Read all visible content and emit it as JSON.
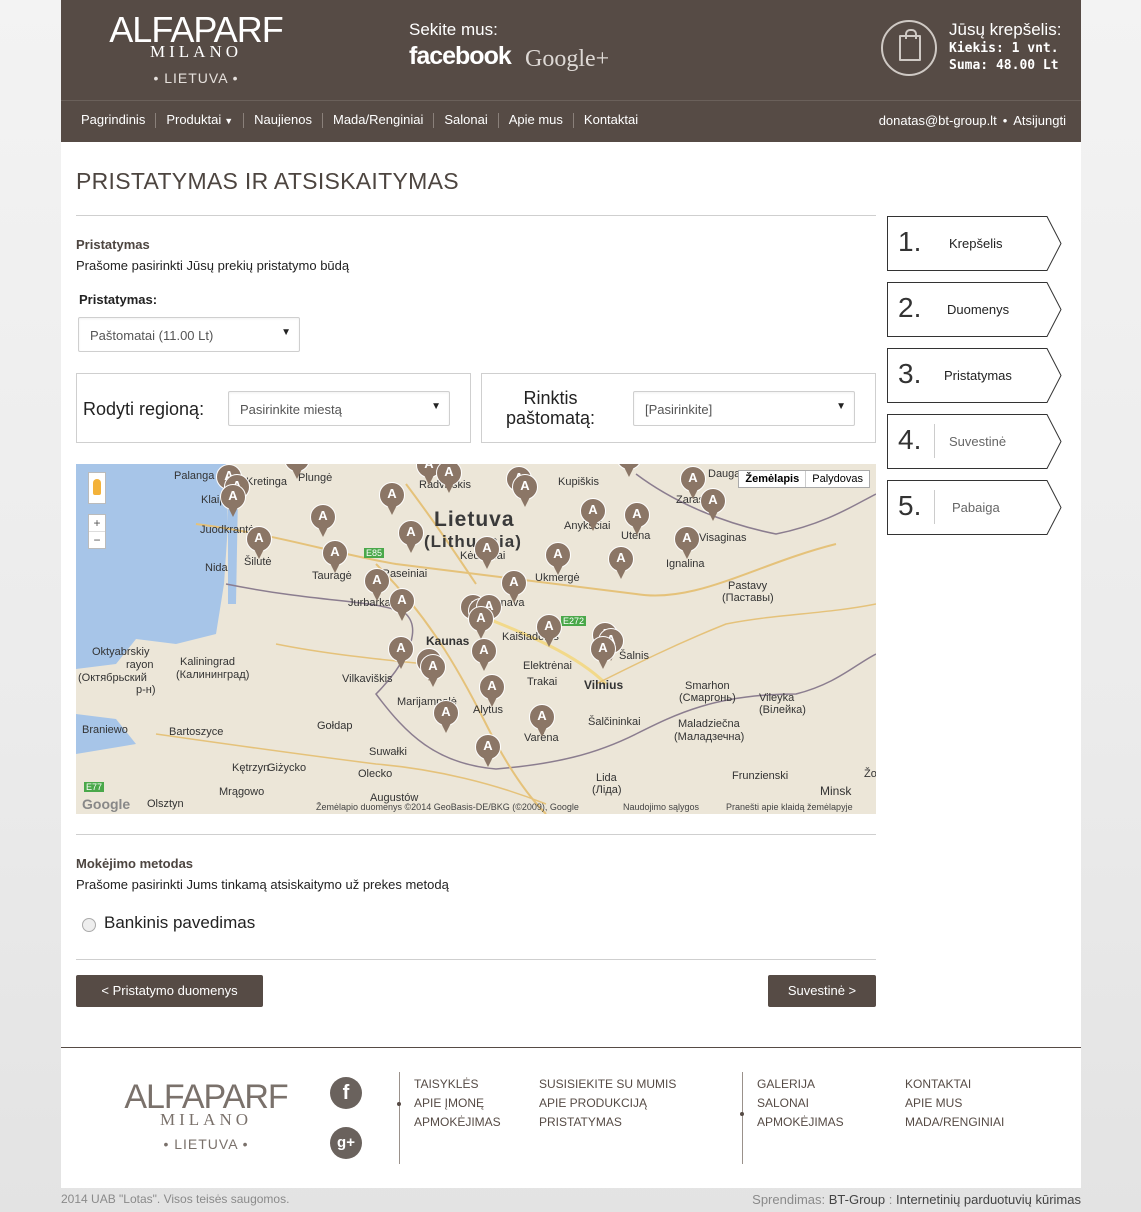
{
  "header": {
    "logo": {
      "line1": "ALFAPARF",
      "line2": "MILANO",
      "line3": "• LIETUVA •"
    },
    "follow_label": "Sekite mus:",
    "facebook": "facebook",
    "google": "Google+",
    "cart_title": "Jūsų krepšelis:",
    "cart_qty": "Kiekis: 1 vnt.",
    "cart_sum": "Suma: 48.00 Lt"
  },
  "nav": {
    "items": [
      "Pagrindinis",
      "Produktai",
      "Naujienos",
      "Mada/Renginiai",
      "Salonai",
      "Apie mus",
      "Kontaktai"
    ],
    "user": "donatas@bt-group.lt",
    "logout": "Atsijungti"
  },
  "page_title": "PRISTATYMAS IR ATSISKAITYMAS",
  "delivery": {
    "title": "Pristatymas",
    "subtitle": "Prašome pasirinkti Jūsų prekių pristatymo būdą",
    "select_label": "Pristatymas:",
    "select_value": "Paštomatai (11.00 Lt)",
    "region_label": "Rodyti regioną:",
    "region_value": "Pasirinkite miestą",
    "locker_label_1": "Rinktis",
    "locker_label_2": "paštomatą:",
    "locker_value": "[Pasirinkite]"
  },
  "map": {
    "type_map": "Žemėlapis",
    "type_sat": "Palydovas",
    "country": "Lietuva",
    "country_alt": "(Lithuania)",
    "attribution": "Žemėlapio duomenys ©2014 GeoBasis-DE/BKG (©2009), Google",
    "terms": "Naudojimo sąlygos",
    "report": "Pranešti apie klaidą žemėlapyje",
    "google": "Google",
    "cities": [
      "Palanga",
      "Kretinga",
      "Plungė",
      "Radviliškis",
      "Kupiškis",
      "Zarasai",
      "Klaipėda",
      "Juodkrantė",
      "Šilutė",
      "Nida",
      "Tauragė",
      "Raseiniai",
      "Jurbarkas",
      "Kėdainiai",
      "Anykščiai",
      "Utena",
      "Visaginas",
      "Ignalina",
      "Ukmergė",
      "Jonava",
      "Kaunas",
      "Kaišiadorys",
      "Elektrėnai",
      "Trakai",
      "Vilnius",
      "Pastavy",
      "(Паставы)",
      "Oktyabrskiy",
      "rayon",
      "(Октябрьский",
      "р-н)",
      "Kaliningrad",
      "(Калининград)",
      "Vilkaviškis",
      "Marijampolė",
      "Alytus",
      "Smarhon",
      "(Смаргонь)",
      "Vileyka",
      "(Вілейка)",
      "Braniewo",
      "Bartoszyce",
      "Gołdap",
      "Varėna",
      "Šalčininkai",
      "Maladziečna",
      "(Маладзечна)",
      "Suwałki",
      "Kętrzyn",
      "Giżycko",
      "Olecko",
      "Lida",
      "(Ліда)",
      "Mrągowo",
      "Augustów",
      "Frunzienski",
      "Olsztyn",
      "Minsk",
      "Daugavp",
      "Šalnis",
      "E85",
      "E272",
      "E77",
      "Žo"
    ]
  },
  "payment": {
    "title": "Mokėjimo metodas",
    "subtitle": "Prašome pasirinkti Jums tinkamą atsiskaitymo už prekes metodą",
    "option": "Bankinis pavedimas"
  },
  "buttons": {
    "back": "< Pristatymo duomenys",
    "next": "Suvestinė >"
  },
  "steps": [
    {
      "n": "1.",
      "label": "Krepšelis"
    },
    {
      "n": "2.",
      "label": "Duomenys"
    },
    {
      "n": "3.",
      "label": "Pristatymas"
    },
    {
      "n": "4.",
      "label": "Suvestinė"
    },
    {
      "n": "5.",
      "label": "Pabaiga"
    }
  ],
  "footer": {
    "logo": {
      "line1": "ALFAPARF",
      "line2": "MILANO",
      "line3": "• LIETUVA •"
    },
    "fb_icon": "f",
    "gp_icon": "g+",
    "col1": [
      "TAISYKLĖS",
      "APIE ĮMONĘ",
      "APMOKĖJIMAS"
    ],
    "col2": [
      "SUSISIEKITE SU MUMIS",
      "APIE PRODUKCIJĄ",
      "PRISTATYMAS"
    ],
    "col3": [
      "GALERIJA",
      "SALONAI",
      "APMOKĖJIMAS"
    ],
    "col4": [
      "KONTAKTAI",
      "APIE MUS",
      "MADA/RENGINIAI"
    ],
    "copyright": "2014 UAB \"Lotas\". Visos teisės saugomos.",
    "credit_prefix": "Sprendimas:",
    "credit_company": "BT-Group",
    "credit_sep": ":",
    "credit_text": "Internetinių parduotuvių kūrimas"
  },
  "colors": {
    "brand": "#564b45",
    "pin": "#8b7666"
  }
}
